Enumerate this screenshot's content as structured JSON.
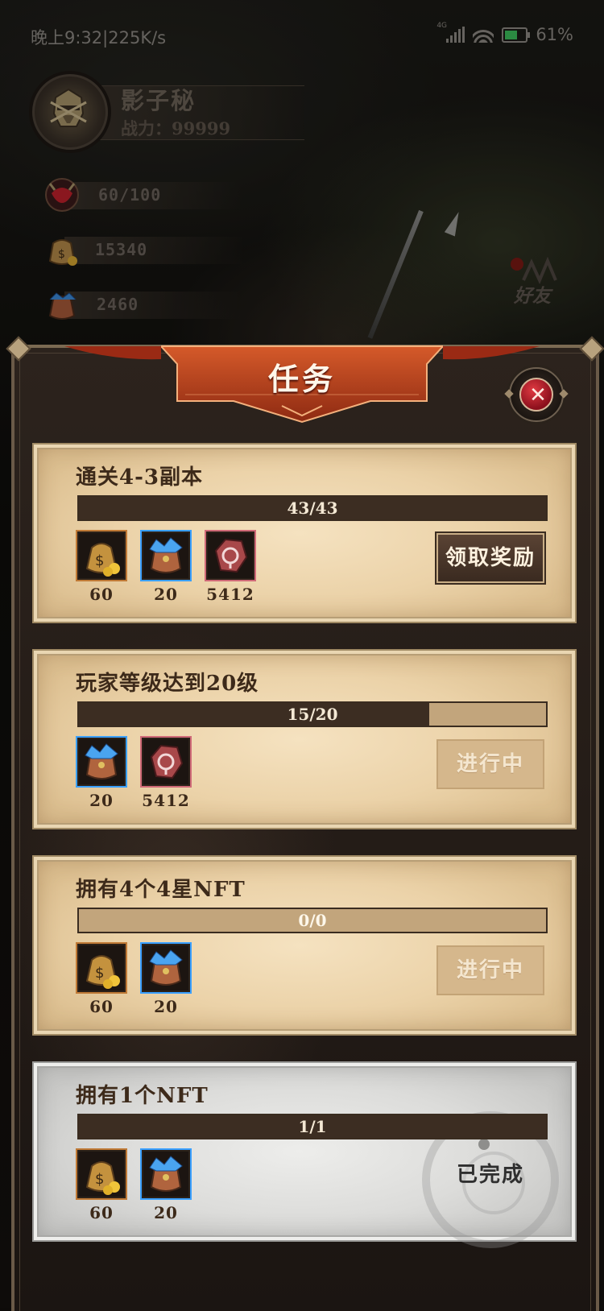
{
  "status_bar": {
    "time": "晚上9:32|225K/s",
    "network_tag": "4G",
    "battery_percent": "61%",
    "battery_level": 0.61
  },
  "profile": {
    "name": "影子秘",
    "power": "战力：99999"
  },
  "resources": [
    {
      "icon": "energy-icon",
      "value": "60/100"
    },
    {
      "icon": "gold-bag-icon",
      "value": "15340"
    },
    {
      "icon": "gem-bag-icon",
      "value": "2460"
    }
  ],
  "friends_label": "好友",
  "dialog": {
    "title": "任务",
    "close_icon": "close-icon"
  },
  "tasks": [
    {
      "title": "通关4-3副本",
      "progress_text": "43/43",
      "progress_fraction": 1.0,
      "rewards": [
        {
          "icon": "gold-bag-icon",
          "qty": "60"
        },
        {
          "icon": "gem-bag-icon",
          "qty": "20"
        },
        {
          "icon": "rune-stone-icon",
          "qty": "5412"
        }
      ],
      "action": "领取奖励",
      "state": "claimable"
    },
    {
      "title": "玩家等级达到20级",
      "progress_text": "15/20",
      "progress_fraction": 0.75,
      "rewards": [
        {
          "icon": "gem-bag-icon",
          "qty": "20"
        },
        {
          "icon": "rune-stone-icon",
          "qty": "5412"
        }
      ],
      "action": "进行中",
      "state": "in_progress"
    },
    {
      "title": "拥有4个4星NFT",
      "progress_text": "0/0",
      "progress_fraction": 0,
      "rewards": [
        {
          "icon": "gold-bag-icon",
          "qty": "60"
        },
        {
          "icon": "gem-bag-icon",
          "qty": "20"
        }
      ],
      "action": "进行中",
      "state": "in_progress"
    },
    {
      "title": "拥有1个NFT",
      "progress_text": "1/1",
      "progress_fraction": 1.0,
      "rewards": [
        {
          "icon": "gold-bag-icon",
          "qty": "60"
        },
        {
          "icon": "gem-bag-icon",
          "qty": "20"
        }
      ],
      "action": "已完成",
      "state": "completed"
    }
  ],
  "colors": {
    "accent_red": "#b23a1c",
    "parchment": "#ebd2a8",
    "progress_fill": "#3c2d22"
  }
}
